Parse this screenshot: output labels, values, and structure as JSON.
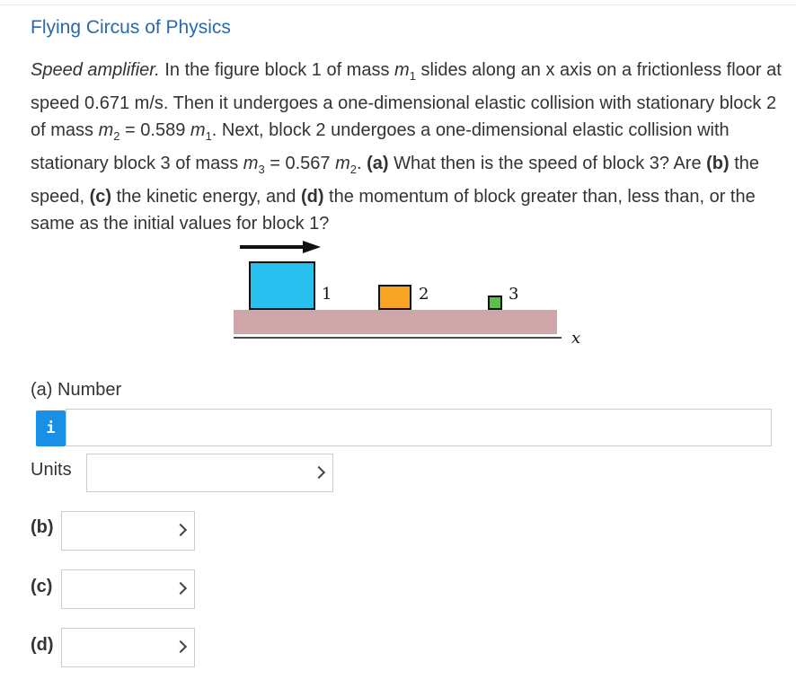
{
  "header": {
    "title": "Flying Circus of Physics"
  },
  "question": {
    "lead_italic": "Speed amplifier.",
    "text_1": " In the figure block 1 of mass ",
    "m1": "m",
    "m1_sub": "1",
    "text_2": " slides along an x axis on a frictionless floor at speed 0.671 m/s. Then it undergoes a one-dimensional elastic collision with stationary block 2 of mass ",
    "m2": "m",
    "m2_sub": "2",
    "text_3": " = 0.589 ",
    "m1b": "m",
    "m1b_sub": "1",
    "text_4": ". Next, block 2 undergoes a one-dimensional elastic collision with stationary block 3 of mass ",
    "m3": "m",
    "m3_sub": "3",
    "text_5": " = 0.567 ",
    "m2b": "m",
    "m2b_sub": "2",
    "text_6": ". ",
    "a_tag": "(a)",
    "a_text": " What then is the speed of block 3? Are ",
    "b_tag": "(b)",
    "b_text": " the speed, ",
    "c_tag": "(c)",
    "c_text": " the kinetic energy, and ",
    "d_tag": "(d)",
    "d_text": " the momentum of block greater than, less than, or the same as the initial values for block 1?"
  },
  "figure": {
    "block1_label": "1",
    "block2_label": "2",
    "block3_label": "3",
    "axis_label": "x",
    "colors": {
      "block1": "#29c0ef",
      "block2": "#f7a425",
      "block3": "#5cbf4a",
      "floor": "#cfa6a9"
    }
  },
  "answer": {
    "part_a_label": "(a) Number",
    "info_icon_text": "i",
    "number_value": "",
    "units_label": "Units",
    "units_value": "",
    "parts": [
      {
        "label": "(b)",
        "value": ""
      },
      {
        "label": "(c)",
        "value": ""
      },
      {
        "label": "(d)",
        "value": ""
      }
    ]
  }
}
